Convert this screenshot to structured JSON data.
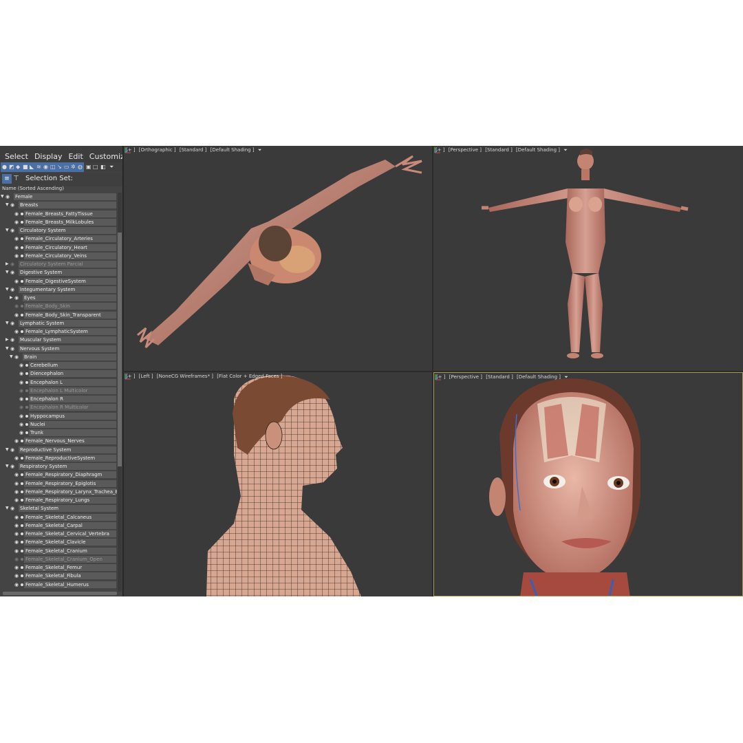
{
  "menu": [
    "Select",
    "Display",
    "Edit",
    "Customize"
  ],
  "selection_set": {
    "label": "Selection Set:"
  },
  "column_header": "Name (Sorted Ascending)",
  "tree": [
    {
      "label": "Female",
      "level": 0,
      "expanded": true,
      "dim": false
    },
    {
      "label": "Breasts",
      "level": 1,
      "expanded": true,
      "dim": false
    },
    {
      "label": "Female_Breasts_FattyTissue",
      "level": 2,
      "dim": false
    },
    {
      "label": "Female_Breasts_MilkLobules",
      "level": 2,
      "dim": false
    },
    {
      "label": "Circulatory System",
      "level": 1,
      "expanded": true,
      "dim": false
    },
    {
      "label": "Female_Circulatory_Arteries",
      "level": 2,
      "dim": false
    },
    {
      "label": "Female_Circulatory_Heart",
      "level": 2,
      "dim": false
    },
    {
      "label": "Female_Circulatory_Veins",
      "level": 2,
      "dim": false
    },
    {
      "label": "Circulatory System Parcial",
      "level": 1,
      "expanded": false,
      "dim": true
    },
    {
      "label": "Digestive System",
      "level": 1,
      "expanded": true,
      "dim": false
    },
    {
      "label": "Female_DigestiveSystem",
      "level": 2,
      "dim": false
    },
    {
      "label": "Integumentary System",
      "level": 1,
      "expanded": true,
      "dim": false
    },
    {
      "label": "Eyes",
      "level": 2,
      "expanded": false,
      "dim": false
    },
    {
      "label": "Female_Body_Skin",
      "level": 2,
      "dim": true
    },
    {
      "label": "Female_Body_Skin_Transparent",
      "level": 2,
      "dim": false
    },
    {
      "label": "Lymphatic System",
      "level": 1,
      "expanded": true,
      "dim": false
    },
    {
      "label": "Female_LymphaticSystem",
      "level": 2,
      "dim": false
    },
    {
      "label": "Muscular System",
      "level": 1,
      "expanded": false,
      "dim": false
    },
    {
      "label": "Nervous System",
      "level": 1,
      "expanded": true,
      "dim": false
    },
    {
      "label": "Brain",
      "level": 2,
      "expanded": true,
      "dim": false
    },
    {
      "label": "Cerebellum",
      "level": 3,
      "dim": false
    },
    {
      "label": "Diencephalon",
      "level": 3,
      "dim": false
    },
    {
      "label": "Encephalon L",
      "level": 3,
      "dim": false
    },
    {
      "label": "Encephalon L Multicolor",
      "level": 3,
      "dim": true
    },
    {
      "label": "Encephalon R",
      "level": 3,
      "dim": false
    },
    {
      "label": "Encephalon R Multicolor",
      "level": 3,
      "dim": true
    },
    {
      "label": "Hyppocampus",
      "level": 3,
      "dim": false
    },
    {
      "label": "Nuclei",
      "level": 3,
      "dim": false
    },
    {
      "label": "Trunk",
      "level": 3,
      "dim": false
    },
    {
      "label": "Female_Nervous_Nerves",
      "level": 2,
      "dim": false
    },
    {
      "label": "Reproductive System",
      "level": 1,
      "expanded": true,
      "dim": false
    },
    {
      "label": "Female_ReproductiveSystem",
      "level": 2,
      "dim": false
    },
    {
      "label": "Respiratory System",
      "level": 1,
      "expanded": true,
      "dim": false
    },
    {
      "label": "Female_Respiratory_Diaphragm",
      "level": 2,
      "dim": false
    },
    {
      "label": "Female_Respiratory_Epiglotis",
      "level": 2,
      "dim": false
    },
    {
      "label": "Female_Respiratory_Larynx_Trachea_Bron",
      "level": 2,
      "dim": false
    },
    {
      "label": "Female_Respiratory_Lungs",
      "level": 2,
      "dim": false
    },
    {
      "label": "Skeletal System",
      "level": 1,
      "expanded": true,
      "dim": false
    },
    {
      "label": "Female_Skeletal_Calcaneus",
      "level": 2,
      "dim": false
    },
    {
      "label": "Female_Skeletal_Carpal",
      "level": 2,
      "dim": false
    },
    {
      "label": "Female_Skeletal_Cervical_Vertebra",
      "level": 2,
      "dim": false
    },
    {
      "label": "Female_Skeletal_Clavicle",
      "level": 2,
      "dim": false
    },
    {
      "label": "Female_Skeletal_Cranium",
      "level": 2,
      "dim": false
    },
    {
      "label": "Female_Skeletal_Cranium_Open",
      "level": 2,
      "dim": true
    },
    {
      "label": "Female_Skeletal_Femur",
      "level": 2,
      "dim": false
    },
    {
      "label": "Female_Skeletal_Fibula",
      "level": 2,
      "dim": false
    },
    {
      "label": "Female_Skeletal_Humerus",
      "level": 2,
      "dim": false
    }
  ],
  "viewports": {
    "top_left": {
      "labels": [
        "[+ ]",
        "[Orthographic ]",
        "[Standard ]",
        "[Default Shading ]"
      ]
    },
    "top_right": {
      "labels": [
        "[+ ]",
        "[Perspective ]",
        "[Standard ]",
        "[Default Shading ]"
      ]
    },
    "bottom_left": {
      "labels": [
        "[+ ]",
        "[Left ]",
        "[NoneCG Wireframes* ]",
        "[Flat Color + Edged Faces ]"
      ]
    },
    "bottom_right": {
      "labels": [
        "[+ ]",
        "[Perspective ]",
        "[Standard ]",
        "[Default Shading ]"
      ]
    }
  },
  "icons": [
    "filter-icon",
    "eye-icon",
    "layers-icon",
    "hierarchy-icon",
    "axis-gizmo-icon"
  ],
  "colors": {
    "selected_toolbar": "#4a6fa5",
    "active_viewport_border": "#a89a4e",
    "skin": "#c98a7a",
    "muscle": "#b9655a"
  }
}
